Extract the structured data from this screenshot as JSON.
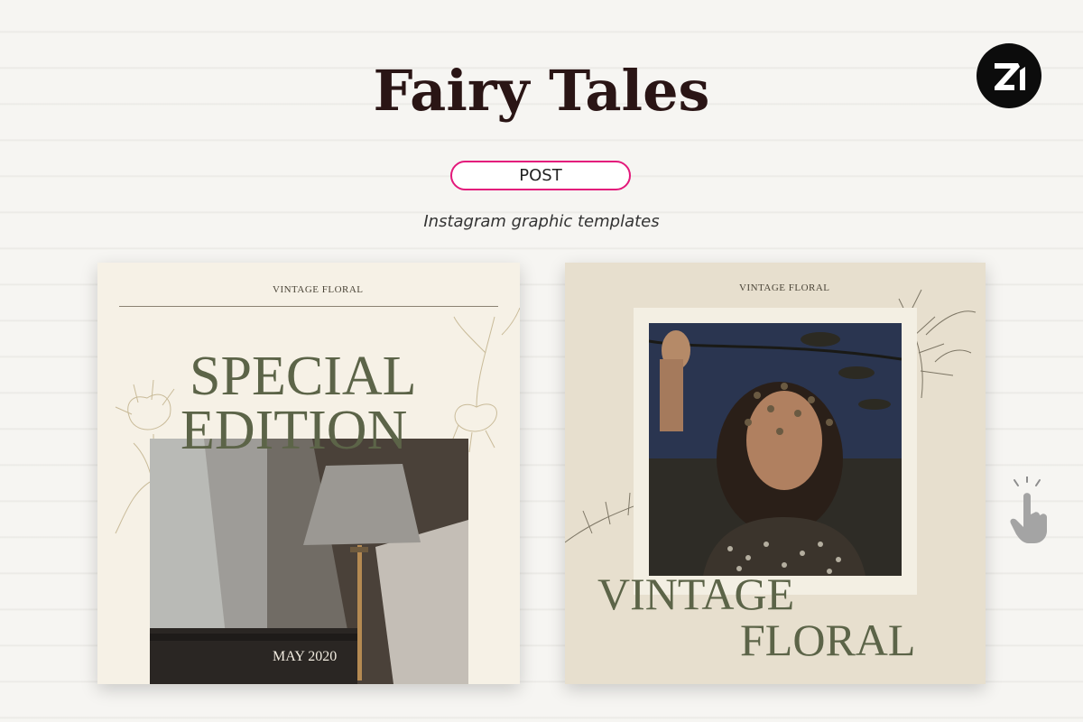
{
  "header": {
    "title": "Fairy Tales",
    "pill_label": "POST",
    "subtitle": "Instagram graphic templates",
    "brand_logo": "zi-logo-icon"
  },
  "cards": [
    {
      "top_label": "VINTAGE FLORAL",
      "headline_line1": "SPECIAL",
      "headline_line2": "EDITION",
      "date": "MAY 2020",
      "photo": "lamp-photo"
    },
    {
      "top_label": "VINTAGE FLORAL",
      "headline_line1": "VINTAGE",
      "headline_line2": "FLORAL",
      "photo": "woman-with-branches-photo"
    }
  ],
  "hint": {
    "icon": "tap-hand-icon"
  },
  "colors": {
    "accent_pink": "#e3197b",
    "title_dark": "#2a1515",
    "olive_text": "#5c6448",
    "card1_bg": "#f6f1e6",
    "card2_bg": "#e7dfce"
  }
}
